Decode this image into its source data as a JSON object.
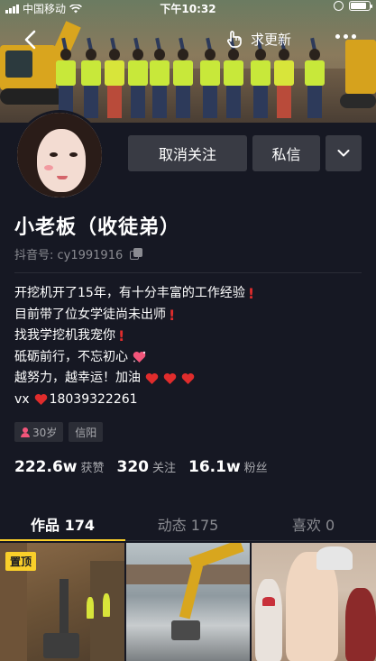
{
  "status_bar": {
    "carrier": "中国移动",
    "time": "下午10:32",
    "battery_level": 0.85
  },
  "nav": {
    "ask_update_label": "求更新"
  },
  "actions": {
    "unfollow_label": "取消关注",
    "message_label": "私信"
  },
  "profile": {
    "name": "小老板（收徒弟）",
    "douyin_id": "抖音号: cy1991916",
    "bio": [
      "开挖机开了15年，有十分丰富的工作经验",
      "目前带了位女学徒尚未出师",
      "找我学挖机我宠你",
      "砥砺前行，不忘初心",
      "越努力，越幸运！加油",
      "vx",
      "18039322261"
    ],
    "tags": {
      "age": "30岁",
      "city": "信阳"
    }
  },
  "stats": [
    {
      "value": "222.6w",
      "label": "获赞"
    },
    {
      "value": "320",
      "label": "关注"
    },
    {
      "value": "16.1w",
      "label": "粉丝"
    }
  ],
  "tabs": [
    {
      "label": "作品 174"
    },
    {
      "label": "动态 175"
    },
    {
      "label": "喜欢 0"
    }
  ],
  "videos": {
    "pinned_label": "置顶"
  },
  "colors": {
    "background": "#161823",
    "button": "#393b44",
    "accent": "#facf2a",
    "alert_red": "#e02c2c",
    "heart_red": "#e02c2c",
    "heart_pink": "#f2557a"
  },
  "icons": [
    "back-icon",
    "hand-point-icon",
    "more-icon",
    "chevron-down-icon",
    "copy-icon",
    "exclamation-icon",
    "heart-icon",
    "sparkling-heart-icon",
    "person-icon"
  ]
}
